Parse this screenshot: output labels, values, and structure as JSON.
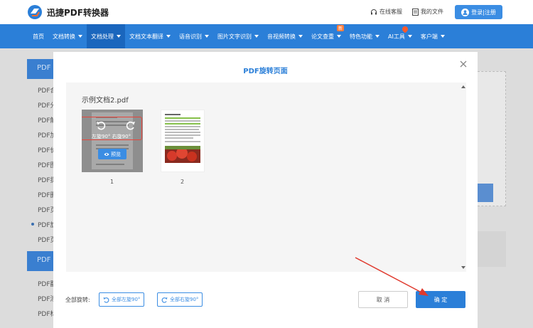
{
  "header": {
    "brand": "迅捷PDF转换器",
    "online_support": "在线客服",
    "my_files": "我的文件",
    "login": "登录|注册"
  },
  "nav": {
    "items": [
      {
        "label": "首页",
        "caret": false
      },
      {
        "label": "文档转换",
        "caret": true
      },
      {
        "label": "文档处理",
        "caret": true,
        "active": true
      },
      {
        "label": "文档文本翻译",
        "caret": true
      },
      {
        "label": "语音识别",
        "caret": true
      },
      {
        "label": "图片文字识别",
        "caret": true
      },
      {
        "label": "音视频转换",
        "caret": true
      },
      {
        "label": "论文查重",
        "caret": true,
        "badge": "新"
      },
      {
        "label": "特色功能",
        "caret": true
      },
      {
        "label": "AI工具",
        "caret": true
      },
      {
        "label": "客户端",
        "caret": true
      }
    ]
  },
  "sidebar": {
    "heading1": "PDF",
    "items": [
      "PDF合",
      "PDF分",
      "PDF解",
      "PDF加",
      "PDF价",
      "PDF图",
      "PDF提",
      "PDF删",
      "PDF页",
      "PDF旋",
      "PDF页"
    ],
    "heading2": "PDF",
    "items2": [
      "PDF翻",
      "PDF添",
      "PDF标"
    ]
  },
  "modal": {
    "title": "PDF旋转页面",
    "file_name": "示例文档2.pdf",
    "rotate_left_label": "左旋90°",
    "rotate_right_label": "右旋90°",
    "preview_label": "预览",
    "pages": [
      "1",
      "2"
    ],
    "rotate_all_label": "全部旋转:",
    "rotate_all_left": "全部左旋90°",
    "rotate_all_right": "全部右旋90°",
    "cancel": "取 消",
    "confirm": "确 定"
  },
  "colors": {
    "primary": "#2b7fd8",
    "highlight": "#e8453c"
  }
}
